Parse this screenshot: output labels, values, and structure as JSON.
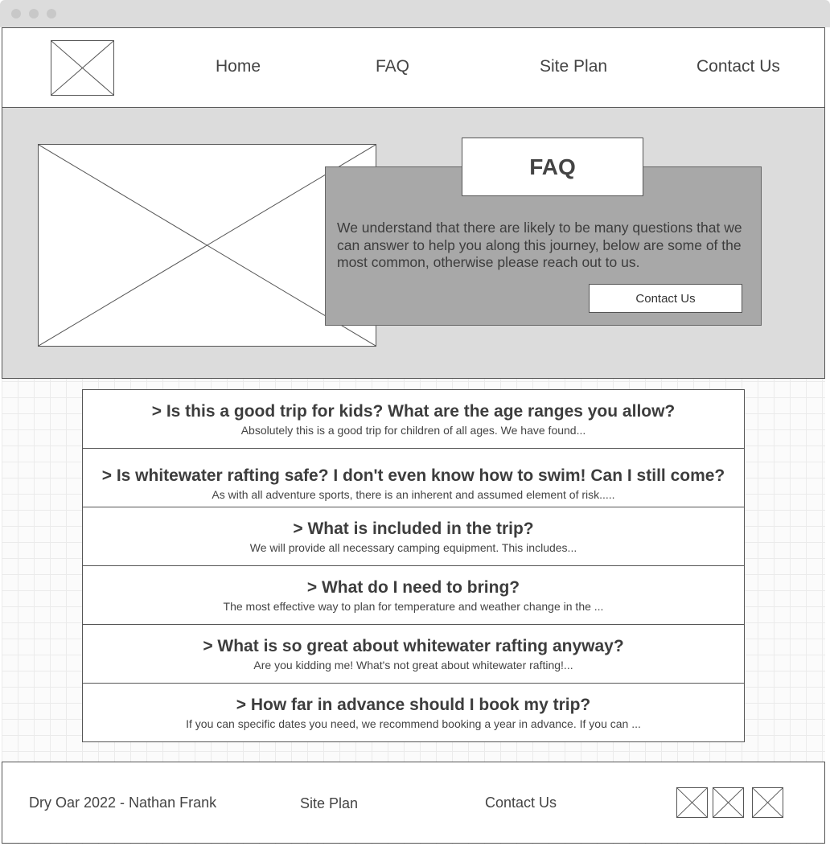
{
  "nav": {
    "items": [
      {
        "label": "Home"
      },
      {
        "label": "FAQ"
      },
      {
        "label": "Site Plan"
      },
      {
        "label": "Contact Us"
      }
    ]
  },
  "hero": {
    "title": "FAQ",
    "description": "We understand that there are likely to be many questions that we can answer to help you along this journey, below are some of the most common, otherwise please reach out to us.",
    "button_label": "Contact Us"
  },
  "faq": {
    "items": [
      {
        "question": "> Is this a good trip for kids? What are the age ranges you allow?",
        "answer": "Absolutely this is a good trip for children of all ages. We have found..."
      },
      {
        "question": "> Is whitewater rafting safe? I don't even know how to swim! Can I still come?",
        "answer": "As with all adventure sports, there is an inherent and assumed element of risk....."
      },
      {
        "question": "> What is included in the trip?",
        "answer": "We will provide all necessary camping equipment. This includes..."
      },
      {
        "question": "> What do I need to bring?",
        "answer": "The most effective way to plan for temperature and weather change in the ..."
      },
      {
        "question": "> What is so great about whitewater rafting anyway?",
        "answer": "Are you kidding me! What's not great about whitewater rafting!..."
      },
      {
        "question": "> How far in advance should I book my trip?",
        "answer": "If you can specific dates you need, we recommend booking a year in advance. If you can ..."
      }
    ]
  },
  "footer": {
    "copyright": "Dry Oar 2022 - Nathan Frank",
    "site_plan_link": "Site Plan",
    "contact_link": "Contact Us"
  }
}
